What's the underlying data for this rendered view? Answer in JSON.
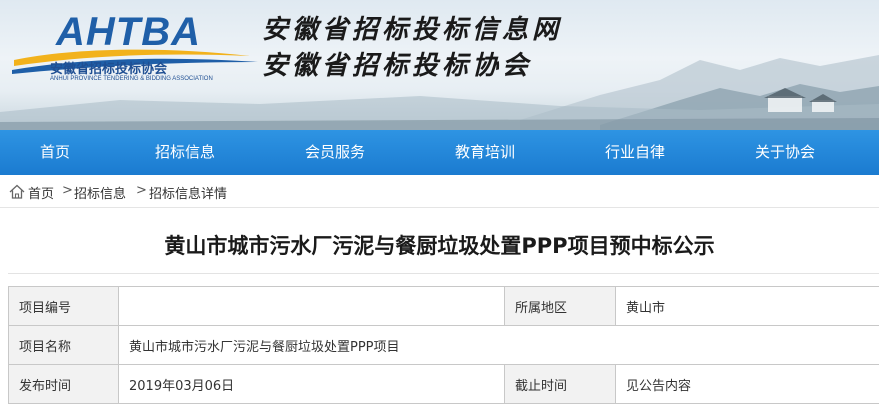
{
  "header": {
    "logo_text": "AHTBA",
    "logo_cn": "安徽省招标投标协会",
    "logo_en": "ANHUI PROVINCE TENDERING & BIDDING ASSOCIATION",
    "title_line1": "安徽省招标投标信息网",
    "title_line2": "安徽省招标投标协会"
  },
  "nav": {
    "items": [
      {
        "label": "首页"
      },
      {
        "label": "招标信息"
      },
      {
        "label": "会员服务"
      },
      {
        "label": "教育培训"
      },
      {
        "label": "行业自律"
      },
      {
        "label": "关于协会"
      }
    ]
  },
  "breadcrumb": {
    "home": "首页",
    "sep": ">",
    "level1": "招标信息",
    "level2": "招标信息详情"
  },
  "article": {
    "title": "黄山市城市污水厂污泥与餐厨垃圾处置PPP项目预中标公示"
  },
  "info_table": {
    "project_no_label": "项目编号",
    "project_no_value": "",
    "region_label": "所属地区",
    "region_value": "黄山市",
    "project_name_label": "项目名称",
    "project_name_value": "黄山市城市污水厂污泥与餐厨垃圾处置PPP项目",
    "publish_time_label": "发布时间",
    "publish_time_value": "2019年03月06日",
    "deadline_label": "截止时间",
    "deadline_value": "见公告内容"
  },
  "colors": {
    "nav_bg": "#1f82d6",
    "logo_blue": "#1f5fa8",
    "label_bg": "#f2f2f2"
  }
}
